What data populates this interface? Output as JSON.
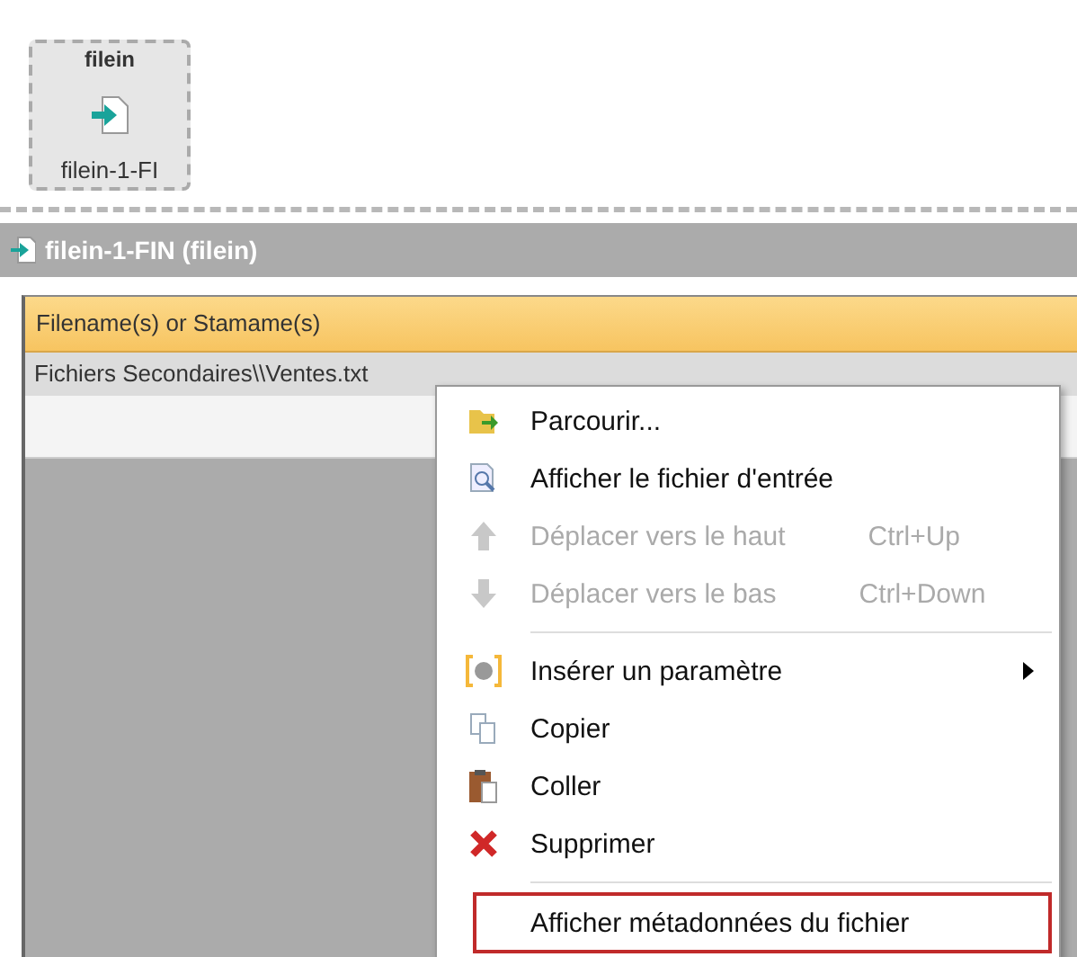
{
  "node": {
    "type": "filein",
    "name": "filein-1-FI"
  },
  "panel": {
    "title": "filein-1-FIN (filein)"
  },
  "grid": {
    "column": "Filename(s) or Stamame(s)",
    "rows": [
      {
        "value": "Fichiers Secondaires\\\\Ventes.txt",
        "selected": true
      }
    ]
  },
  "context_menu": {
    "items": [
      {
        "kind": "item",
        "label": "Parcourir...",
        "disabled": false,
        "highlighted": false
      },
      {
        "kind": "item",
        "label": "Afficher le fichier d'entrée",
        "disabled": false,
        "highlighted": false
      },
      {
        "kind": "item",
        "label": "Déplacer vers le haut",
        "shortcut": "Ctrl+Up",
        "disabled": true,
        "highlighted": false
      },
      {
        "kind": "item",
        "label": "Déplacer vers le bas",
        "shortcut": "Ctrl+Down",
        "disabled": true,
        "highlighted": false
      },
      {
        "kind": "separator"
      },
      {
        "kind": "submenu",
        "label": "Insérer un paramètre",
        "disabled": false,
        "highlighted": false
      },
      {
        "kind": "item",
        "label": "Copier",
        "disabled": false,
        "highlighted": false
      },
      {
        "kind": "item",
        "label": "Coller",
        "disabled": false,
        "highlighted": false
      },
      {
        "kind": "item",
        "label": "Supprimer",
        "disabled": false,
        "highlighted": false
      },
      {
        "kind": "separator"
      },
      {
        "kind": "item",
        "label": "Afficher métadonnées du fichier",
        "disabled": false,
        "highlighted": true
      }
    ]
  }
}
